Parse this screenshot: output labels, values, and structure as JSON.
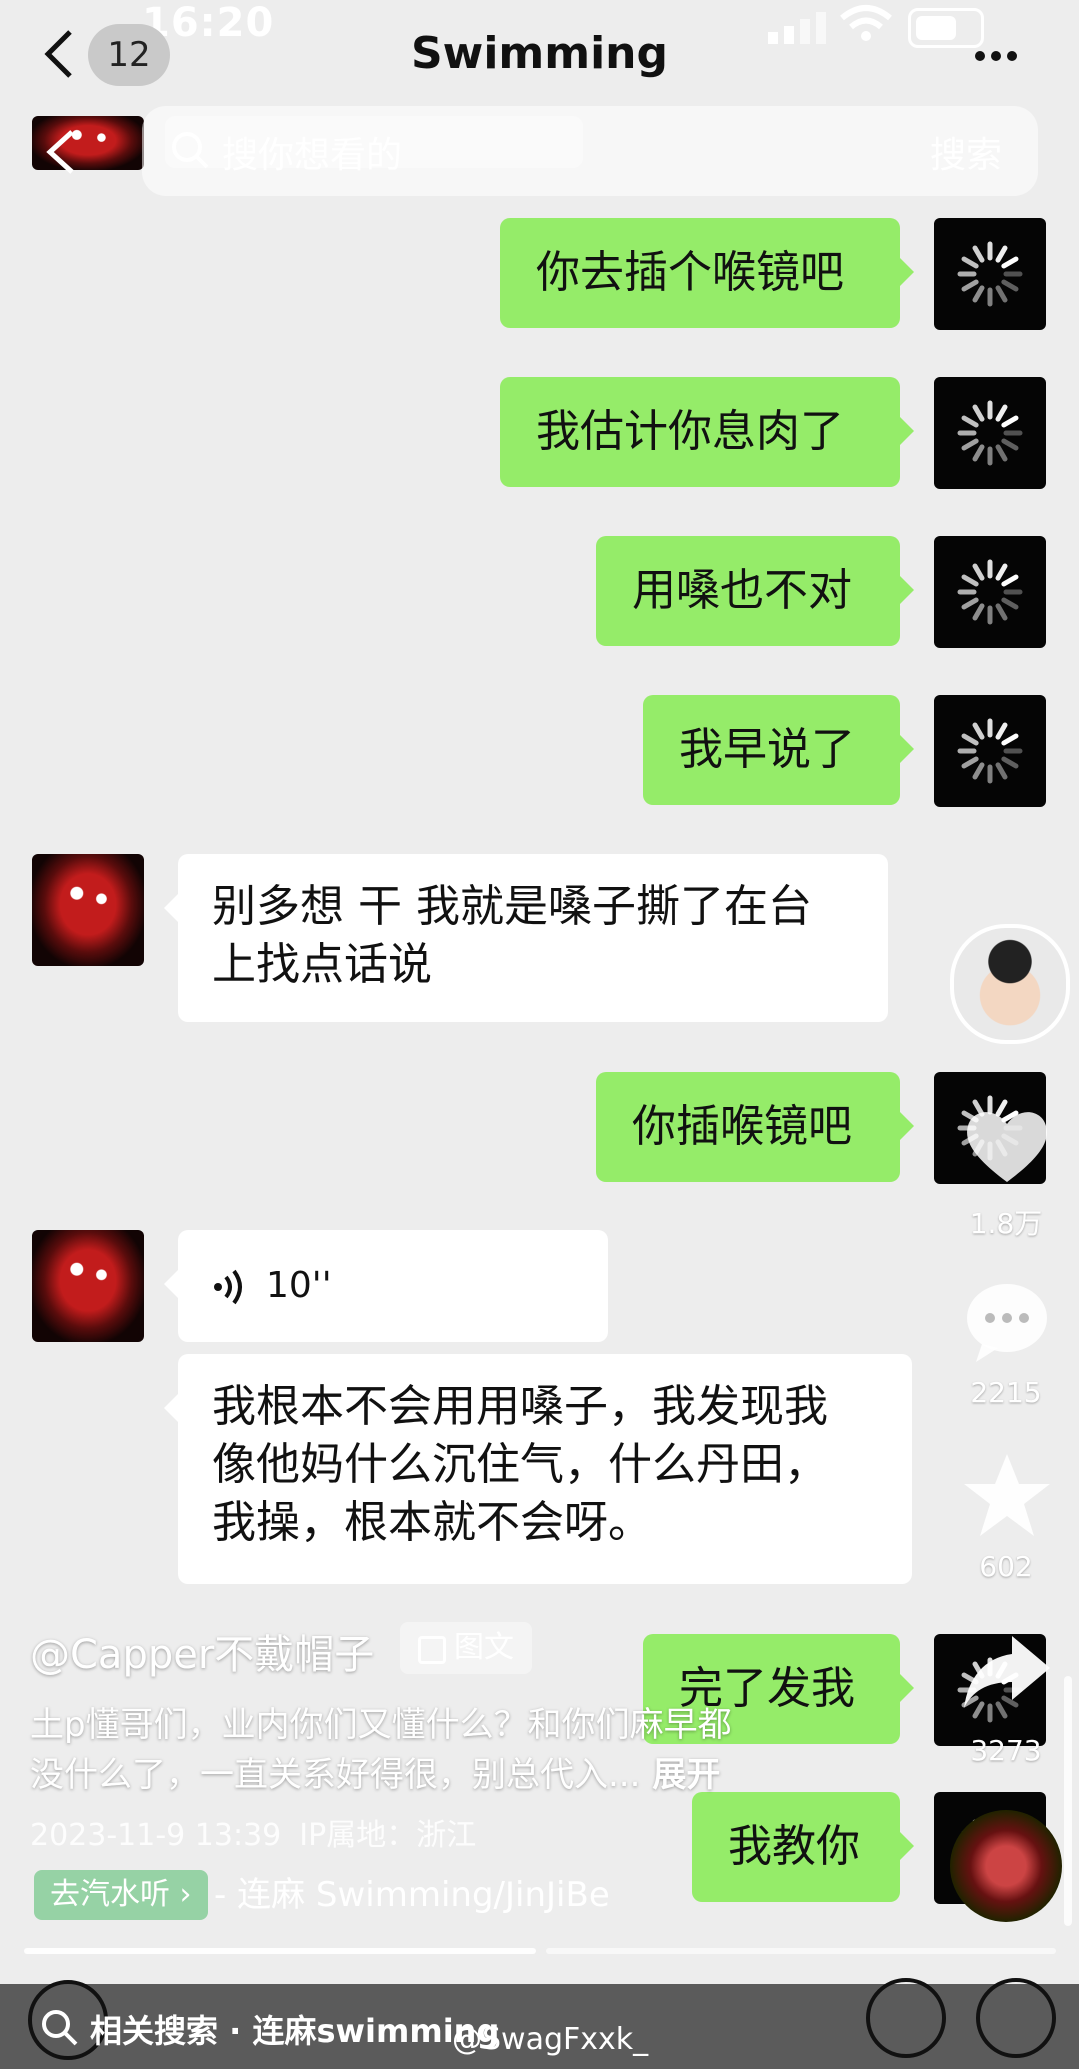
{
  "status_bar": {
    "time": "16:20"
  },
  "header": {
    "unread_count": "12",
    "title": "Swimming"
  },
  "search": {
    "placeholder": "搜你想看的",
    "button": "搜索"
  },
  "messages": [
    {
      "side": "me",
      "text": "你去插个喉镜吧"
    },
    {
      "side": "me",
      "text": "我估计你息肉了"
    },
    {
      "side": "me",
      "text": "用嗓也不对"
    },
    {
      "side": "me",
      "text": "我早说了"
    },
    {
      "side": "other",
      "line1": "别多想 干 我就是嗓子撕了在台",
      "line2": "上找点话说"
    },
    {
      "side": "me",
      "text": "你插喉镜吧"
    },
    {
      "side": "other",
      "voice_duration": "10''"
    },
    {
      "side": "other",
      "line1": "我根本不会用用嗓子，我发现我",
      "line2": "像他妈什么沉住气，什么丹田，",
      "line3": "我操，根本就不会呀。"
    },
    {
      "side": "me",
      "text": "完了发我"
    },
    {
      "side": "me",
      "text": "我教你"
    }
  ],
  "rail": {
    "likes": "1.8万",
    "comments": "2215",
    "favorites": "602",
    "shares": "3273"
  },
  "post": {
    "author": "@Capper不戴帽子",
    "type": "图文",
    "caption_line1": "土p懂哥们，业内你们又懂什么？和你们麻早都",
    "caption_line2": "没什么了，一直关系好得很，别总代入...",
    "expand": "展开",
    "date": "2023-11-9 13:39",
    "ip": "IP属地：浙江",
    "music_tag": "去汽水听",
    "music_title": "- 连麻 Swimming/JinJiBe"
  },
  "bottom": {
    "related": "相关搜索 · 连麻swimming",
    "watermark": "@SwagFxxk_"
  },
  "colors": {
    "me_bubble": "#95ec69",
    "other_bubble": "#ffffff",
    "bg": "#ededed"
  }
}
